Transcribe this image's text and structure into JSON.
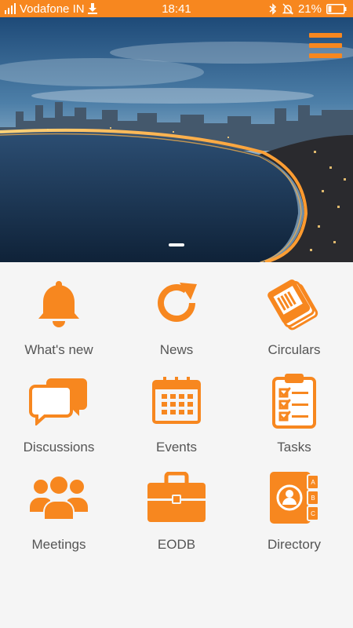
{
  "status_bar": {
    "carrier": "Vodafone IN",
    "time": "18:41",
    "battery": "21%",
    "battery_level": 0.21
  },
  "colors": {
    "accent": "#f7871f",
    "background": "#f5f5f5",
    "label": "#555555"
  },
  "hero": {
    "pager_total": 1,
    "pager_active": 1
  },
  "tiles": [
    {
      "label": "What's new",
      "icon": "bell-icon"
    },
    {
      "label": "News",
      "icon": "refresh-icon"
    },
    {
      "label": "Circulars",
      "icon": "circulars-icon"
    },
    {
      "label": "Discussions",
      "icon": "chat-bubbles-icon"
    },
    {
      "label": "Events",
      "icon": "calendar-icon"
    },
    {
      "label": "Tasks",
      "icon": "clipboard-checklist-icon"
    },
    {
      "label": "Meetings",
      "icon": "group-icon"
    },
    {
      "label": "EODB",
      "icon": "briefcase-icon"
    },
    {
      "label": "Directory",
      "icon": "address-book-icon"
    }
  ]
}
